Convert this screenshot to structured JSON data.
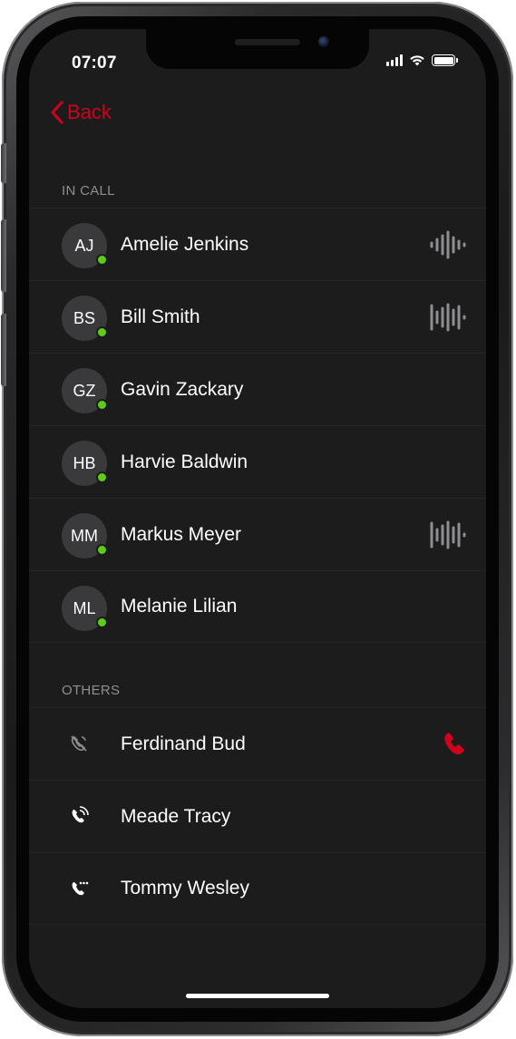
{
  "status_bar": {
    "time": "07:07"
  },
  "nav": {
    "back_label": "Back"
  },
  "in_call": {
    "header": "IN CALL",
    "participants": [
      {
        "initials": "AJ",
        "name": "Amelie Jenkins",
        "speaking": true
      },
      {
        "initials": "BS",
        "name": "Bill Smith",
        "speaking": true
      },
      {
        "initials": "GZ",
        "name": "Gavin Zackary",
        "speaking": false
      },
      {
        "initials": "HB",
        "name": "Harvie Baldwin",
        "speaking": false
      },
      {
        "initials": "MM",
        "name": "Markus Meyer",
        "speaking": true
      },
      {
        "initials": "ML",
        "name": "Melanie Lilian",
        "speaking": false
      }
    ]
  },
  "others": {
    "header": "OTHERS",
    "contacts": [
      {
        "name": "Ferdinand Bud",
        "status_icon": "call-declined-icon",
        "action_icon": "phone-red-icon"
      },
      {
        "name": "Meade Tracy",
        "status_icon": "call-ringing-icon"
      },
      {
        "name": "Tommy Wesley",
        "status_icon": "call-waiting-icon"
      }
    ]
  },
  "colors": {
    "accent_red": "#d0021b",
    "online_green": "#5ecb1a",
    "background": "#1c1c1d"
  }
}
